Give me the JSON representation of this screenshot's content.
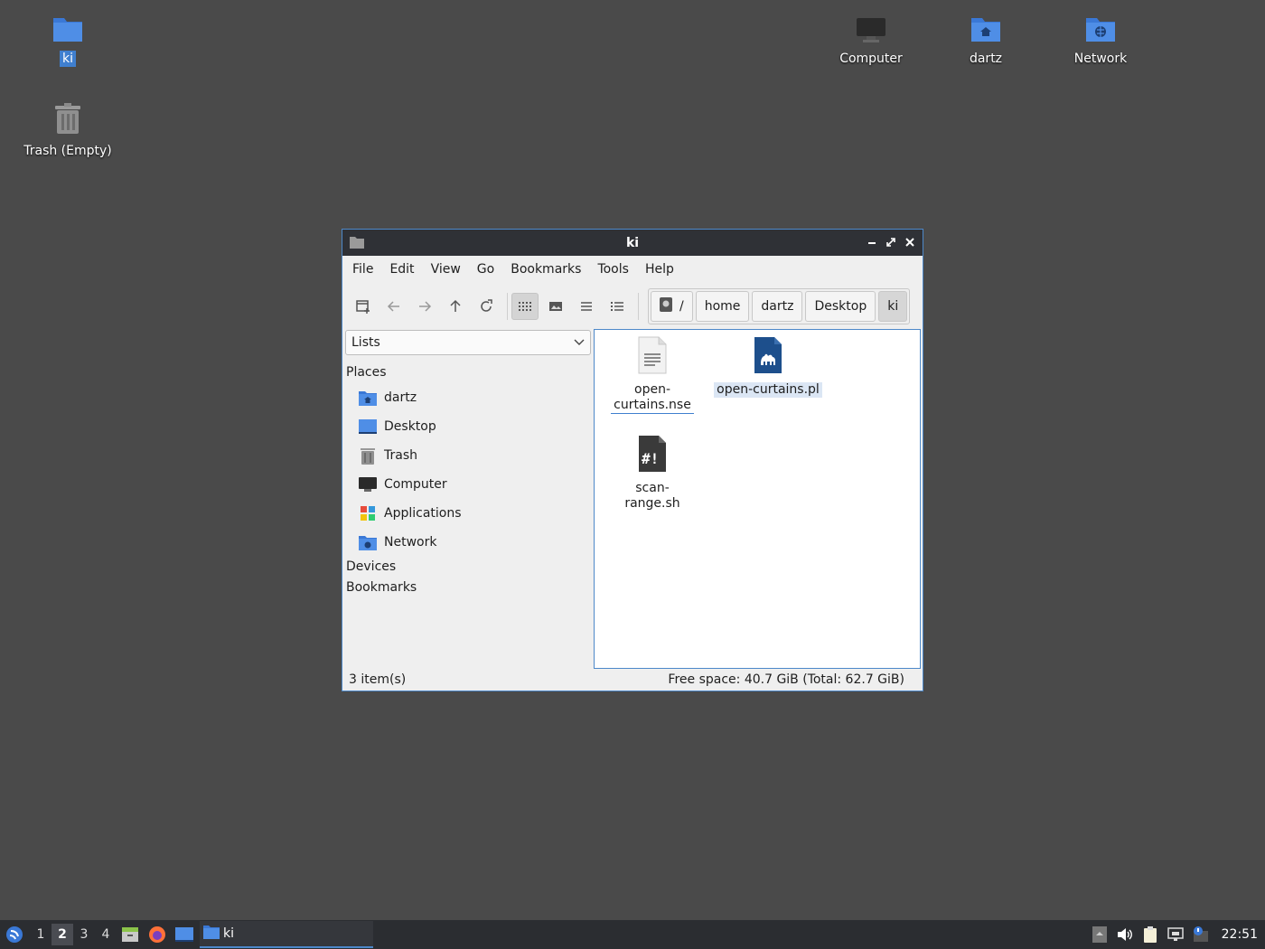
{
  "desktop": {
    "icons": [
      {
        "label": "ki"
      },
      {
        "label": "Trash (Empty)"
      },
      {
        "label": "Computer"
      },
      {
        "label": "dartz"
      },
      {
        "label": "Network"
      }
    ]
  },
  "window": {
    "title": "ki",
    "menu": [
      "File",
      "Edit",
      "View",
      "Go",
      "Bookmarks",
      "Tools",
      "Help"
    ],
    "breadcrumbs": [
      "/",
      "home",
      "dartz",
      "Desktop",
      "ki"
    ],
    "sidebar": {
      "mode": "Lists",
      "places_header": "Places",
      "places": [
        "dartz",
        "Desktop",
        "Trash",
        "Computer",
        "Applications",
        "Network"
      ],
      "devices_header": "Devices",
      "bookmarks_header": "Bookmarks"
    },
    "files": [
      {
        "name": "open-curtains.nse",
        "line1": "open-",
        "line2": "curtains.nse"
      },
      {
        "name": "open-curtains.pl"
      },
      {
        "name": "scan-range.sh"
      }
    ],
    "status": {
      "count": "3 item(s)",
      "free": "Free space: 40.7 GiB (Total: 62.7 GiB)"
    }
  },
  "taskbar": {
    "workspaces": [
      "1",
      "2",
      "3",
      "4"
    ],
    "current_workspace": "2",
    "task_label": "ki",
    "clock": "22:51"
  },
  "colors": {
    "desktop_bg": "#4a4a4a",
    "accent": "#4d88c9",
    "folder_blue": "#4f8ee6"
  }
}
